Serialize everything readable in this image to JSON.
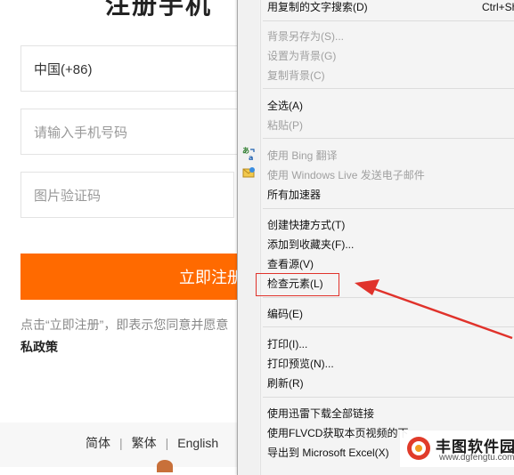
{
  "page": {
    "title_fragment": "注册手机",
    "country_code": "中国(+86)",
    "phone_placeholder": "请输入手机号码",
    "captcha_placeholder": "图片验证码",
    "register_button": "立即注册",
    "agreement_line1": "点击“立即注册”，即表示您同意并愿意",
    "agreement_line2": "私政策",
    "footer_langs": [
      "简体",
      "繁体",
      "English"
    ],
    "accent_color": "#ff6a00"
  },
  "context_menu": {
    "items": [
      {
        "label": "用复制的文字搜索(D)",
        "shortcut": "Ctrl+Shift+L",
        "disabled": false
      },
      {
        "label": "背景另存为(S)...",
        "disabled": true
      },
      {
        "label": "设置为背景(G)",
        "disabled": true
      },
      {
        "label": "复制背景(C)",
        "disabled": true
      },
      {
        "label": "全选(A)",
        "disabled": false
      },
      {
        "label": "粘贴(P)",
        "disabled": true
      },
      {
        "label": "使用 Bing 翻译",
        "disabled": true,
        "icon": "translate-icon"
      },
      {
        "label": "使用 Windows Live 发送电子邮件",
        "disabled": true,
        "icon": "mail-icon"
      },
      {
        "label": "所有加速器",
        "disabled": false
      },
      {
        "label": "创建快捷方式(T)",
        "disabled": false
      },
      {
        "label": "添加到收藏夹(F)...",
        "disabled": false
      },
      {
        "label": "查看源(V)",
        "disabled": false
      },
      {
        "label": "检查元素(L)",
        "disabled": false,
        "highlighted": true
      },
      {
        "label": "编码(E)",
        "disabled": false
      },
      {
        "label": "打印(I)...",
        "disabled": false
      },
      {
        "label": "打印预览(N)...",
        "disabled": false
      },
      {
        "label": "刷新(R)",
        "disabled": false
      },
      {
        "label": "使用迅雷下载全部链接",
        "disabled": false
      },
      {
        "label": "使用FLVCD获取本页视频的下",
        "disabled": false
      },
      {
        "label": "导出到 Microsoft Excel(X)",
        "disabled": false
      }
    ],
    "highlight_color": "#e0322b"
  },
  "watermark": {
    "name": "丰图软件园",
    "url": "www.dgfengtu.com"
  }
}
